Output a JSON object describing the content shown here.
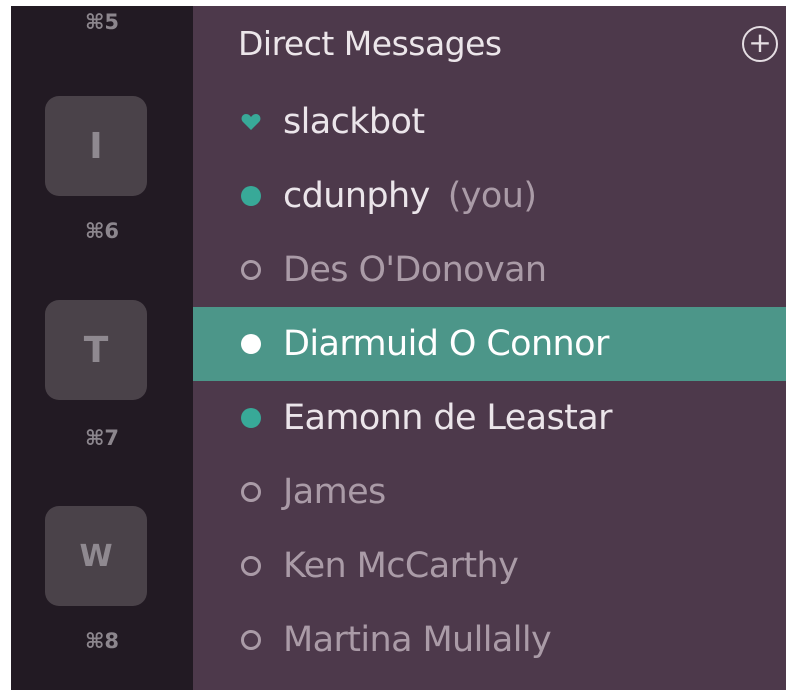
{
  "team_rail": {
    "shortcuts": [
      "⌘5",
      "⌘6",
      "⌘7",
      "⌘8"
    ],
    "teams": [
      {
        "initial": "I"
      },
      {
        "initial": "T"
      },
      {
        "initial": "W"
      }
    ]
  },
  "sidebar": {
    "section_title": "Direct Messages",
    "add_button_glyph": "+",
    "direct_messages": [
      {
        "name": "slackbot",
        "status": "bot-heart"
      },
      {
        "name": "cdunphy",
        "suffix": "(you)",
        "status": "online"
      },
      {
        "name": "Des O'Donovan",
        "status": "offline"
      },
      {
        "name": "Diarmuid O Connor",
        "status": "online",
        "selected": true
      },
      {
        "name": "Eamonn de Leastar",
        "status": "online"
      },
      {
        "name": "James",
        "status": "offline"
      },
      {
        "name": "Ken McCarthy",
        "status": "offline"
      },
      {
        "name": "Martina Mullally",
        "status": "offline"
      }
    ]
  },
  "colors": {
    "rail_background": "#221a23",
    "sidebar_background": "#4d394b",
    "selected_row": "#4c9689",
    "presence_online": "#38a998"
  },
  "icons": {
    "add": "plus-circle-icon",
    "slackbot": "heart-icon",
    "online": "presence-online-icon",
    "offline": "presence-offline-icon"
  }
}
